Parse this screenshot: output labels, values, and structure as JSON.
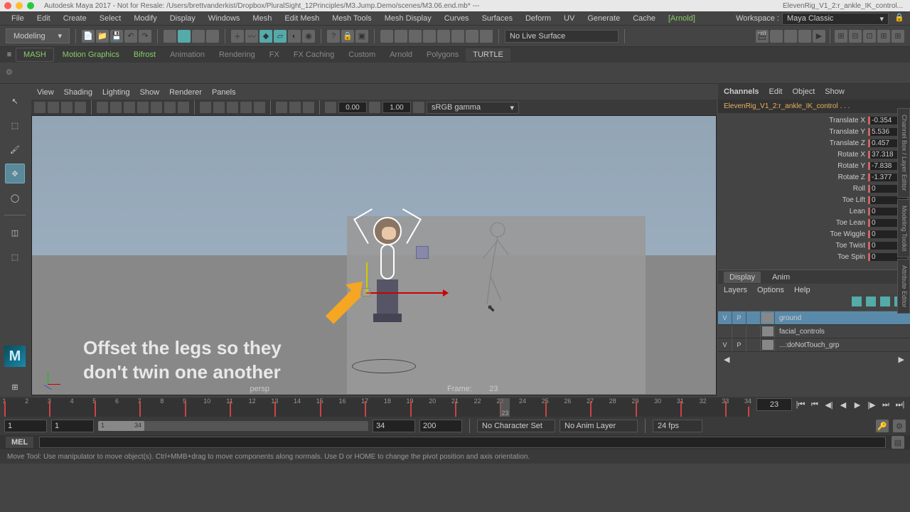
{
  "title": {
    "app": "Autodesk Maya 2017 - Not for Resale: /Users/brettvanderkist/Dropbox/PluralSight_12Principles/M3.Jump.Demo/scenes/M3.06.end.mb*   ---",
    "selection_short": "ElevenRig_V1_2:r_ankle_IK_control..."
  },
  "menubar": [
    "File",
    "Edit",
    "Create",
    "Select",
    "Modify",
    "Display",
    "Windows",
    "Mesh",
    "Edit Mesh",
    "Mesh Tools",
    "Mesh Display",
    "Curves",
    "Surfaces",
    "Deform",
    "UV",
    "Generate",
    "Cache"
  ],
  "menubar_arnold": "[Arnold]",
  "workspace": {
    "label": "Workspace :",
    "value": "Maya Classic"
  },
  "mode_selector": "Modeling",
  "no_live_surface": "No Live Surface",
  "shelf_tabs": {
    "mash": "MASH",
    "motion_graphics": "Motion Graphics",
    "bifrost": "Bifrost",
    "items": [
      "Animation",
      "Rendering",
      "FX",
      "FX Caching",
      "Custom",
      "Arnold",
      "Polygons",
      "TURTLE"
    ]
  },
  "viewport_menu": [
    "View",
    "Shading",
    "Lighting",
    "Show",
    "Renderer",
    "Panels"
  ],
  "viewport_toolbar": {
    "val1": "0.00",
    "val2": "1.00",
    "colorspace": "sRGB gamma"
  },
  "viewport_footer": {
    "camera": "persp",
    "frame_label": "Frame:",
    "frame_value": "23"
  },
  "annotation": "Offset the legs so they\ndon't twin one another",
  "channel_box": {
    "tabs": [
      "Channels",
      "Edit",
      "Object",
      "Show"
    ],
    "selection": "ElevenRig_V1_2:r_ankle_IK_control . . .",
    "attrs": [
      {
        "label": "Translate X",
        "value": "-0.354"
      },
      {
        "label": "Translate Y",
        "value": "5.536"
      },
      {
        "label": "Translate Z",
        "value": "0.457"
      },
      {
        "label": "Rotate X",
        "value": "37.318"
      },
      {
        "label": "Rotate Y",
        "value": "-7.838"
      },
      {
        "label": "Rotate Z",
        "value": "-1.377"
      },
      {
        "label": "Roll",
        "value": "0"
      },
      {
        "label": "Toe Lift",
        "value": "0"
      },
      {
        "label": "Lean",
        "value": "0"
      },
      {
        "label": "Toe Lean",
        "value": "0"
      },
      {
        "label": "Toe Wiggle",
        "value": "0"
      },
      {
        "label": "Toe Twist",
        "value": "0"
      },
      {
        "label": "Toe Spin",
        "value": "0"
      }
    ]
  },
  "display_tabs": {
    "display": "Display",
    "anim": "Anim"
  },
  "layers_menu": [
    "Layers",
    "Options",
    "Help"
  ],
  "layers": [
    {
      "v": "V",
      "p": "P",
      "r": "",
      "name": "ground",
      "sel": true
    },
    {
      "v": "",
      "p": "",
      "r": "",
      "name": "facial_controls",
      "sel": false
    },
    {
      "v": "V",
      "p": "P",
      "r": "",
      "name": "...:doNotTouch_grp",
      "sel": false
    }
  ],
  "vertical_tabs": [
    "Channel Box / Layer Editor",
    "Modeling Toolkit",
    "Attribute Editor"
  ],
  "timeline": {
    "ticks": [
      1,
      2,
      3,
      4,
      5,
      6,
      7,
      8,
      9,
      10,
      11,
      12,
      13,
      14,
      15,
      16,
      17,
      18,
      19,
      20,
      21,
      22,
      23,
      24,
      25,
      26,
      27,
      28,
      29,
      30,
      31,
      32,
      33,
      34
    ],
    "keyframes": [
      1,
      3,
      5,
      7,
      9,
      11,
      13,
      15,
      17,
      19,
      21,
      23,
      25,
      27,
      29,
      31,
      33,
      34
    ],
    "current": 23,
    "current_input": "23"
  },
  "range": {
    "start_outer": "1",
    "start_inner": "1",
    "end_inner": "34",
    "end_outer": "34",
    "range_end": "200",
    "character_set": "No Character Set",
    "anim_layer": "No Anim Layer",
    "fps": "24 fps"
  },
  "cmd": {
    "lang": "MEL"
  },
  "help_line": "Move Tool: Use manipulator to move object(s). Ctrl+MMB+drag to move components along normals. Use D or HOME to change the pivot position and axis orientation.",
  "maya_logo": "M"
}
